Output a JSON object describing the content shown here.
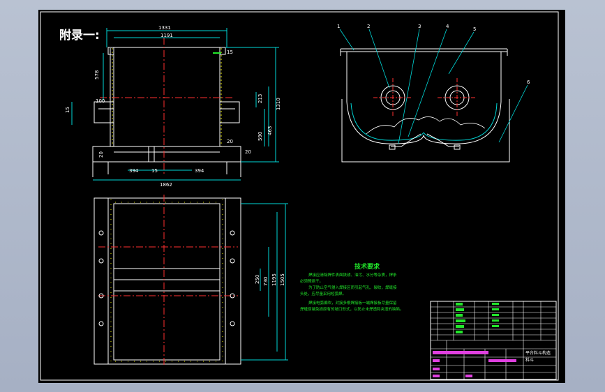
{
  "title": "附录一:",
  "dims": {
    "w1331": "1331",
    "w1191": "1191",
    "d15a": "15",
    "h578": "578",
    "h15": "15",
    "h100": "100",
    "h213": "213",
    "h1310": "1310",
    "h590": "590",
    "h463": "463",
    "d20a": "20",
    "d20b": "20",
    "d20c": "20",
    "w394a": "394",
    "w15": "15",
    "w394b": "394",
    "w1862": "1862",
    "h250": "250",
    "h730": "730",
    "h1195": "1195",
    "h1505": "1505"
  },
  "balloons": [
    "1",
    "2",
    "3",
    "4",
    "5",
    "6"
  ],
  "tech": {
    "heading": "技术要求",
    "line1": "焊接应清除焊件表面铁锈、油污、水分等杂质，焊条",
    "line2": "必须预烘干。",
    "line3": "为了防止空气侵入焊接区而引起气孔、裂纹，焊缝接",
    "line4": "头处，应尽量采用短弧焊。",
    "line5": "焊接电弧偏吹，对接多根焊接板一端焊接板尽量保留",
    "line6": "焊缝原端免损原有的坡口形式，以防止未焊透和夹渣的缺陷。"
  },
  "titleblock": {
    "name1": "平台料斗构造",
    "name2": "料斗"
  },
  "colors": {
    "line": "#ffffff",
    "dim": "#00d7d7",
    "center": "#ff3030",
    "text": "#ffffff",
    "green": "#22e62b",
    "magenta": "#e040e0",
    "yellow": "#e6e600"
  }
}
